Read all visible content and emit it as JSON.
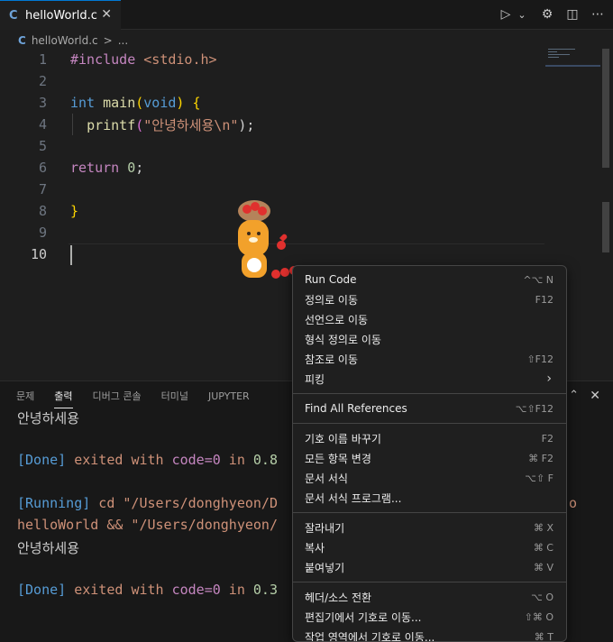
{
  "tab": {
    "lang": "C",
    "name": "helloWorld.c",
    "close": "✕"
  },
  "toolbar": {
    "run_icon": "play-icon",
    "dropdown_icon": "chevron-down-icon",
    "settings_icon": "gear-icon",
    "split_icon": "split-editor-icon",
    "more_icon": "more-icon",
    "run": "▷",
    "dropdown": "⌄",
    "settings": "⚙",
    "split": "◫",
    "more": "⋯"
  },
  "breadcrumb": {
    "lang": "C",
    "file": "helloWorld.c",
    "sep": ">",
    "more": "..."
  },
  "editor": {
    "line_numbers": [
      "1",
      "2",
      "3",
      "4",
      "5",
      "6",
      "7",
      "8",
      "9",
      "10"
    ],
    "lines": {
      "l1_a": "#include",
      "l1_b": " <stdio.h>",
      "l3_a": "int",
      "l3_b": " ",
      "l3_c": "main",
      "l3_d": "(",
      "l3_e": "void",
      "l3_f": ")",
      "l3_g": " {",
      "l4_a": "  ",
      "l4_b": "printf",
      "l4_c": "(",
      "l4_d": "\"안녕하세용\\n\"",
      "l4_e": ");",
      "l6_a": "return",
      "l6_b": " ",
      "l6_c": "0",
      "l6_d": ";",
      "l8_a": "}"
    }
  },
  "panel": {
    "tabs": [
      "문제",
      "출력",
      "디버그 콘솔",
      "터미널",
      "JUPYTER"
    ],
    "active_tab": "출력",
    "close": "✕",
    "maximize": "⌃",
    "output": {
      "line1": "안녕하세용",
      "line3_done": "[Done]",
      "line3_exited": " exited ",
      "line3_with": "with ",
      "line3_code": "code=0",
      "line3_in": " in ",
      "line3_num": "0.8",
      "line5_running": "[Running]",
      "line5_rest": " cd \"/Users/donghyeon/D",
      "line5_tail": "-o",
      "line6_a": "helloWorld && \"/Users/donghyeon/",
      "line7": "안녕하세용",
      "line9_done": "[Done]",
      "line9_exited": " exited ",
      "line9_with": "with ",
      "line9_code": "code=0",
      "line9_in": " in ",
      "line9_num": "0.3"
    }
  },
  "context_menu": {
    "items": [
      {
        "label": "Run Code",
        "shortcut": "^⌥ N"
      },
      {
        "label": "정의로 이동",
        "shortcut": "F12"
      },
      {
        "label": "선언으로 이동",
        "shortcut": ""
      },
      {
        "label": "형식 정의로 이동",
        "shortcut": ""
      },
      {
        "label": "참조로 이동",
        "shortcut": "⇧F12"
      },
      {
        "label": "피킹",
        "shortcut": "›"
      },
      {
        "label": "Find All References",
        "shortcut": "⌥⇧F12"
      },
      {
        "label": "기호 이름 바꾸기",
        "shortcut": "F2"
      },
      {
        "label": "모든 항목 변경",
        "shortcut": "⌘ F2"
      },
      {
        "label": "문서 서식",
        "shortcut": "⌥⇧ F"
      },
      {
        "label": "문서 서식 프로그램...",
        "shortcut": ""
      },
      {
        "label": "잘라내기",
        "shortcut": "⌘ X"
      },
      {
        "label": "복사",
        "shortcut": "⌘ C"
      },
      {
        "label": "붙여넣기",
        "shortcut": "⌘ V"
      },
      {
        "label": "헤더/소스 전환",
        "shortcut": "⌥ O"
      },
      {
        "label": "편집기에서 기호로 이동...",
        "shortcut": "⇧⌘ O"
      },
      {
        "label": "작업 영역에서 기호로 이동...",
        "shortcut": "⌘ T"
      }
    ]
  },
  "colors": {
    "accent": "#0078d4",
    "background": "#1e1e1e",
    "menu_bg": "#1f1f1f"
  }
}
